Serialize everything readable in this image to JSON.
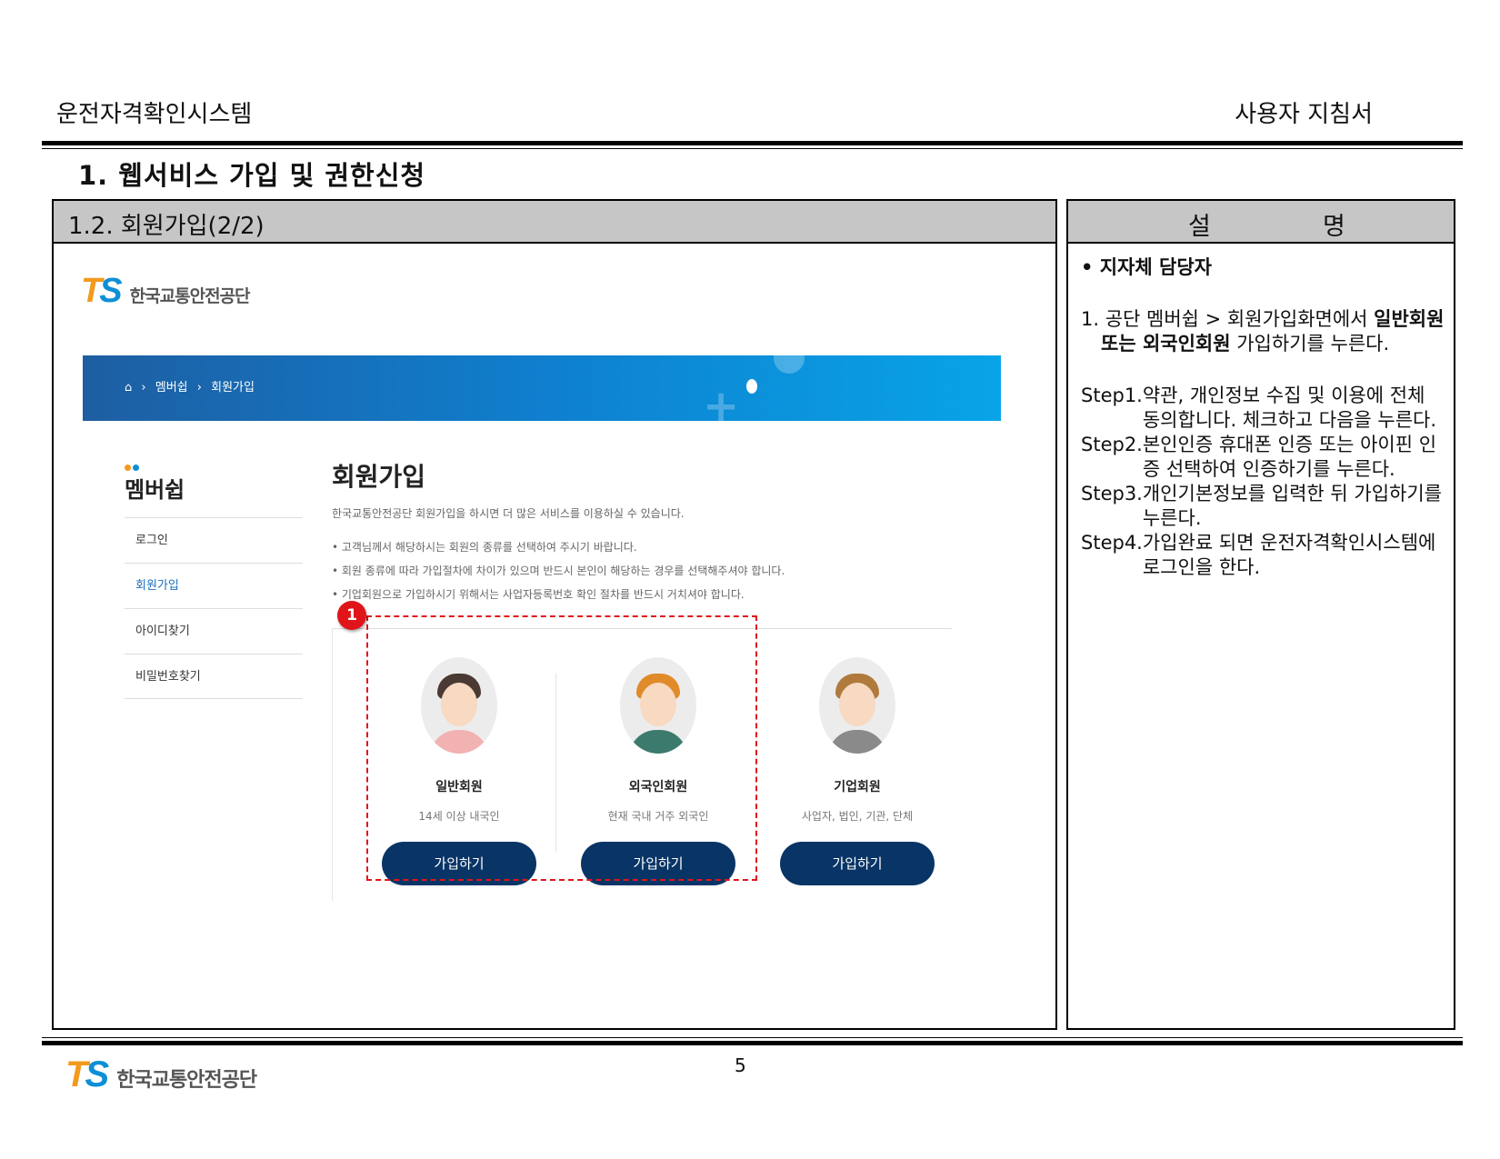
{
  "header": {
    "doc_title": "운전자격확인시스템",
    "doc_type": "사용자 지침서"
  },
  "section_title": "1. 웹서비스 가입 및 권한신청",
  "left_panel": {
    "subsection_title": "1.2. 회원가입(2/2)",
    "site": {
      "logo_mark_t": "T",
      "logo_mark_s": "S",
      "logo_name": "한국교통안전공단",
      "breadcrumb": {
        "home_icon": "home-icon",
        "sep": "›",
        "item1": "멤버쉽",
        "item2": "회원가입"
      },
      "sidebar": {
        "title": "멤버쉽",
        "items": [
          {
            "label": "로그인"
          },
          {
            "label": "회원가입"
          },
          {
            "label": "아이디찾기"
          },
          {
            "label": "비밀번호찾기"
          }
        ]
      },
      "page_heading": "회원가입",
      "intro": "한국교통안전공단 회원가입을 하시면 더 많은 서비스를 이용하실 수 있습니다.",
      "notices": [
        "• 고객님께서 해당하시는 회원의 종류를 선택하여 주시기 바랍니다.",
        "• 회원 종류에 따라 가입절차에 차이가 있으며 반드시 본인이 해당하는 경우를 선택해주셔야 합니다.",
        "• 기업회원으로 가입하시기 위해서는 사업자등록번호 확인 절차를 반드시 거치셔야 합니다."
      ],
      "cards": [
        {
          "title": "일반회원",
          "desc": "14세 이상 내국인",
          "button": "가입하기"
        },
        {
          "title": "외국인회원",
          "desc": "현재 국내 거주 외국인",
          "button": "가입하기"
        },
        {
          "title": "기업회원",
          "desc": "사업자, 법인, 기관, 단체",
          "button": "가입하기"
        }
      ],
      "callout_number": "1"
    }
  },
  "right_panel": {
    "header_left": "설",
    "header_right": "명",
    "bullet_head": "• 지자체 담당자",
    "item1": {
      "prefix": "1. 공단 멤버쉽 > 회원가입화면에서 ",
      "bold1": "일반회원",
      "mid": " 또는 ",
      "bold2": "외국인회원",
      "suffix": " 가입하기를 누른다."
    },
    "steps": [
      {
        "label": "Step1.",
        "text": "약관, 개인정보 수집 및 이용에 전체 동의합니다. 체크하고 다음을 누른다."
      },
      {
        "label": "Step2.",
        "text": "본인인증 휴대폰 인증 또는 아이핀 인증 선택하여 인증하기를 누른다."
      },
      {
        "label": "Step3.",
        "text": "개인기본정보를 입력한 뒤 가입하기를 누른다."
      },
      {
        "label": "Step4.",
        "text": "가입완료 되면 운전자격확인시스템에 로그인을 한다."
      }
    ]
  },
  "footer": {
    "logo_name": "한국교통안전공단",
    "page_number": "5"
  },
  "colors": {
    "brand_orange": "#f39a1e",
    "brand_blue": "#0d8fd6",
    "button_navy": "#093466",
    "callout_red": "#e0151a",
    "header_gray": "#c6c6c6"
  }
}
